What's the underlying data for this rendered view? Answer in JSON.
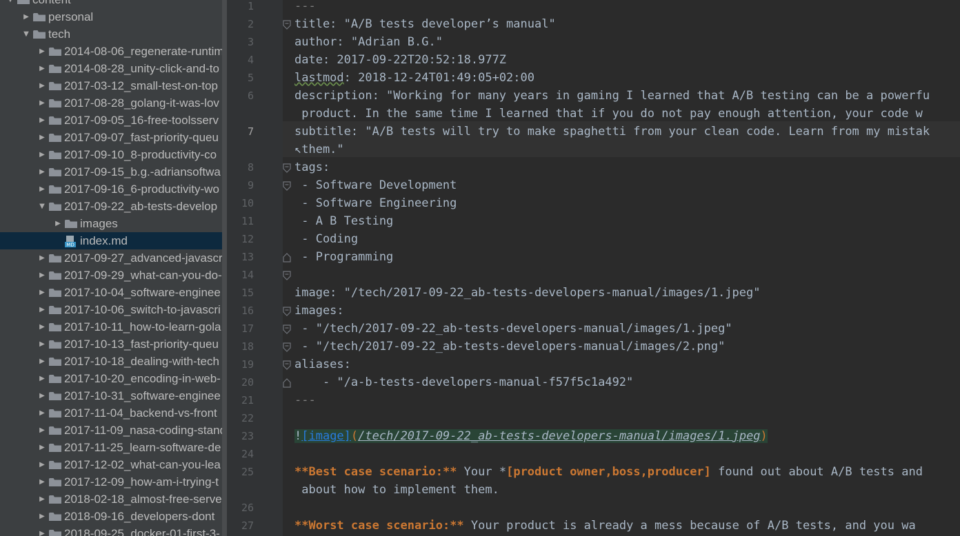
{
  "tree": {
    "rows": [
      {
        "label": "content",
        "depth": 0,
        "expanded": true,
        "type": "folder"
      },
      {
        "label": "personal",
        "depth": 1,
        "expanded": false,
        "type": "folder"
      },
      {
        "label": "tech",
        "depth": 1,
        "expanded": true,
        "type": "folder"
      },
      {
        "label": "2014-08-06_regenerate-runtim",
        "depth": 2,
        "expanded": false,
        "type": "folder"
      },
      {
        "label": "2014-08-28_unity-click-and-to",
        "depth": 2,
        "expanded": false,
        "type": "folder"
      },
      {
        "label": "2017-03-12_small-test-on-top",
        "depth": 2,
        "expanded": false,
        "type": "folder"
      },
      {
        "label": "2017-08-28_golang-it-was-lov",
        "depth": 2,
        "expanded": false,
        "type": "folder"
      },
      {
        "label": "2017-09-05_16-free-toolsserv",
        "depth": 2,
        "expanded": false,
        "type": "folder"
      },
      {
        "label": "2017-09-07_fast-priority-queu",
        "depth": 2,
        "expanded": false,
        "type": "folder"
      },
      {
        "label": "2017-09-10_8-productivity-co",
        "depth": 2,
        "expanded": false,
        "type": "folder"
      },
      {
        "label": "2017-09-15_b.g.-adriansoftwa",
        "depth": 2,
        "expanded": false,
        "type": "folder"
      },
      {
        "label": "2017-09-16_6-productivity-wo",
        "depth": 2,
        "expanded": false,
        "type": "folder"
      },
      {
        "label": "2017-09-22_ab-tests-develop",
        "depth": 2,
        "expanded": true,
        "type": "folder"
      },
      {
        "label": "images",
        "depth": 3,
        "expanded": false,
        "type": "folder"
      },
      {
        "label": "index.md",
        "depth": 3,
        "expanded": false,
        "type": "md",
        "selected": true
      },
      {
        "label": "2017-09-27_advanced-javascr",
        "depth": 2,
        "expanded": false,
        "type": "folder"
      },
      {
        "label": "2017-09-29_what-can-you-do-",
        "depth": 2,
        "expanded": false,
        "type": "folder"
      },
      {
        "label": "2017-10-04_software-enginee",
        "depth": 2,
        "expanded": false,
        "type": "folder"
      },
      {
        "label": "2017-10-06_switch-to-javascri",
        "depth": 2,
        "expanded": false,
        "type": "folder"
      },
      {
        "label": "2017-10-11_how-to-learn-gola",
        "depth": 2,
        "expanded": false,
        "type": "folder"
      },
      {
        "label": "2017-10-13_fast-priority-queu",
        "depth": 2,
        "expanded": false,
        "type": "folder"
      },
      {
        "label": "2017-10-18_dealing-with-tech",
        "depth": 2,
        "expanded": false,
        "type": "folder"
      },
      {
        "label": "2017-10-20_encoding-in-web-",
        "depth": 2,
        "expanded": false,
        "type": "folder"
      },
      {
        "label": "2017-10-31_software-enginee",
        "depth": 2,
        "expanded": false,
        "type": "folder"
      },
      {
        "label": "2017-11-04_backend-vs-front",
        "depth": 2,
        "expanded": false,
        "type": "folder"
      },
      {
        "label": "2017-11-09_nasa-coding-stand",
        "depth": 2,
        "expanded": false,
        "type": "folder"
      },
      {
        "label": "2017-11-25_learn-software-de",
        "depth": 2,
        "expanded": false,
        "type": "folder"
      },
      {
        "label": "2017-12-02_what-can-you-lea",
        "depth": 2,
        "expanded": false,
        "type": "folder"
      },
      {
        "label": "2017-12-09_how-am-i-trying-t",
        "depth": 2,
        "expanded": false,
        "type": "folder"
      },
      {
        "label": "2018-02-18_almost-free-serve",
        "depth": 2,
        "expanded": false,
        "type": "folder"
      },
      {
        "label": "2018-09-16_developers-dont",
        "depth": 2,
        "expanded": false,
        "type": "folder"
      },
      {
        "label": "2018-09-25_docker-01-first-3-",
        "depth": 2,
        "expanded": false,
        "type": "folder"
      }
    ]
  },
  "editor": {
    "current_line": "7",
    "line_numbers": [
      "1",
      "2",
      "3",
      "4",
      "5",
      "6",
      "",
      "7",
      "",
      "8",
      "9",
      "10",
      "11",
      "12",
      "13",
      "14",
      "15",
      "16",
      "17",
      "18",
      "19",
      "20",
      "21",
      "22",
      "23",
      "24",
      "25",
      "",
      "26",
      "27"
    ],
    "lines": {
      "l1": "---",
      "l2": "title: \"A/B tests developer’s manual\"",
      "l3": "author: \"Adrian B.G.\"",
      "l4": "date: 2017-09-22T20:52:18.977Z",
      "l5_key": "lastmod",
      "l5_rest": ": 2018-12-24T01:49:05+02:00",
      "l6": "description: \"Working for many years in gaming I learned that A/B testing can be a powerfu",
      "l6b": " product. In the same time I learned that if you do not pay enough attention, your code w",
      "l7": "subtitle: \"A/B tests will try to make spaghetti from your clean code. Learn from my mistak",
      "l7b": "↖them.\"",
      "l8": "tags:",
      "l9": " - Software Development",
      "l10": " - Software Engineering",
      "l11": " - A B Testing",
      "l12": " - Coding",
      "l13": " - Programming",
      "l15": "image: \"/tech/2017-09-22_ab-tests-developers-manual/images/1.jpeg\"",
      "l16": "images:",
      "l17": " - \"/tech/2017-09-22_ab-tests-developers-manual/images/1.jpeg\"",
      "l18": " - \"/tech/2017-09-22_ab-tests-developers-manual/images/2.png\"",
      "l19": "aliases:",
      "l20": "    - \"/a-b-tests-developers-manual-f57f5c1a492\"",
      "l21": "---",
      "l23_bang": "!",
      "l23_alt": "[image]",
      "l23_open": "(",
      "l23_url": "/tech/2017-09-22_ab-tests-developers-manual/images/1.jpeg",
      "l23_close": ")",
      "l25_b1": "**",
      "l25_bold": "Best case scenario:",
      "l25_b2": "**",
      "l25_text1": " Your *",
      "l25_hl": "[product owner,boss,producer]",
      "l25_text2": " found out about A/B tests and",
      "l25b": " about how to implement them.",
      "l27_b1": "**",
      "l27_bold": "Worst case scenario:",
      "l27_b2": "**",
      "l27_text": " Your product is already a mess because of A/B tests, and you wa"
    }
  },
  "colors": {
    "tree_bg": "#3c3f41",
    "selected_row": "#0d293e",
    "editor_bg": "#2b2b2b",
    "gutter_bg": "#313335",
    "markdown_bold": "#cc7832",
    "link": "#287bde",
    "folder": "#8d9299"
  }
}
